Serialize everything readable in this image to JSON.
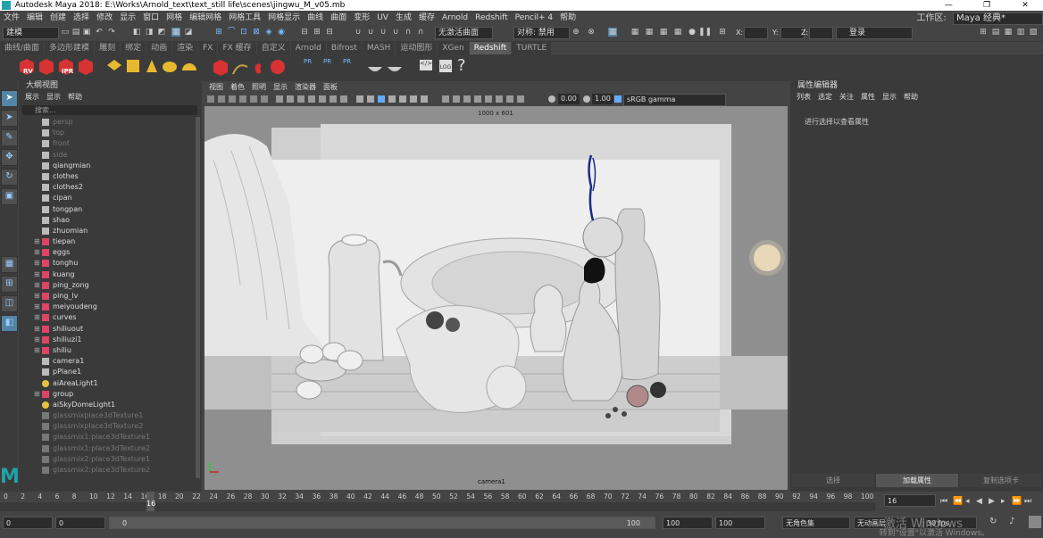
{
  "window": {
    "title": "Autodesk Maya 2018: E:\\Works\\Arnold_text\\text_still life\\scenes\\jingwu_M_v05.mb",
    "min": "—",
    "restore": "❐",
    "close": "✕"
  },
  "menubar": {
    "items": [
      "文件",
      "编辑",
      "创建",
      "选择",
      "修改",
      "显示",
      "窗口",
      "网格",
      "编辑网格",
      "网格工具",
      "网格显示",
      "曲线",
      "曲面",
      "变形",
      "UV",
      "生成",
      "缓存",
      "Arnold",
      "Redshift",
      "Pencil+ 4",
      "帮助"
    ],
    "workspace_label": "工作区:",
    "workspace_value": "Maya 经典*"
  },
  "statusline": {
    "mode": "建模",
    "live_surface": "无激活曲面",
    "symmetry": "对称: 禁用",
    "x": "X:",
    "y": "Y:",
    "z": "Z:",
    "login": "登录"
  },
  "shelf_tabs": [
    "曲线/曲面",
    "多边形建模",
    "雕刻",
    "绑定",
    "动画",
    "渲染",
    "FX",
    "FX 缓存",
    "自定义",
    "Arnold",
    "Bifrost",
    "MASH",
    "运动图形",
    "XGen",
    "Redshift",
    "TURTLE"
  ],
  "shelf_active": "Redshift",
  "shelf_labels": {
    "rv": "RV",
    "ipr": "IPR",
    "pr1": "PR",
    "pr2": "PR",
    "pr3": "PR",
    "log": "LOG",
    "help": "?"
  },
  "outliner": {
    "title": "大纲视图",
    "menus": [
      "展示",
      "显示",
      "帮助"
    ],
    "search_placeholder": "搜索...",
    "items": [
      {
        "name": "persp",
        "type": "camera",
        "dim": true,
        "expand": false
      },
      {
        "name": "top",
        "type": "camera",
        "dim": true,
        "expand": false
      },
      {
        "name": "front",
        "type": "camera",
        "dim": true,
        "expand": false
      },
      {
        "name": "side",
        "type": "camera",
        "dim": true,
        "expand": false
      },
      {
        "name": "qiangmian",
        "type": "mesh",
        "dim": false,
        "expand": false
      },
      {
        "name": "clothes",
        "type": "mesh",
        "dim": false,
        "expand": false
      },
      {
        "name": "clothes2",
        "type": "mesh",
        "dim": false,
        "expand": false
      },
      {
        "name": "cipan",
        "type": "mesh",
        "dim": false,
        "expand": false
      },
      {
        "name": "tongpan",
        "type": "mesh",
        "dim": false,
        "expand": false
      },
      {
        "name": "shao",
        "type": "mesh",
        "dim": false,
        "expand": false
      },
      {
        "name": "zhuomian",
        "type": "mesh",
        "dim": false,
        "expand": false
      },
      {
        "name": "tiepan",
        "type": "group",
        "dim": false,
        "expand": true
      },
      {
        "name": "eggs",
        "type": "group",
        "dim": false,
        "expand": true
      },
      {
        "name": "tonghu",
        "type": "group",
        "dim": false,
        "expand": true
      },
      {
        "name": "kuang",
        "type": "group",
        "dim": false,
        "expand": true
      },
      {
        "name": "ping_zong",
        "type": "group",
        "dim": false,
        "expand": true
      },
      {
        "name": "ping_lv",
        "type": "group",
        "dim": false,
        "expand": true
      },
      {
        "name": "meiyoudeng",
        "type": "group",
        "dim": false,
        "expand": true
      },
      {
        "name": "curves",
        "type": "group",
        "dim": false,
        "expand": true
      },
      {
        "name": "shiliuout",
        "type": "group",
        "dim": false,
        "expand": true
      },
      {
        "name": "shiliuzi1",
        "type": "group",
        "dim": false,
        "expand": true
      },
      {
        "name": "shiliu",
        "type": "group",
        "dim": false,
        "expand": true
      },
      {
        "name": "camera1",
        "type": "camera",
        "dim": false,
        "expand": false
      },
      {
        "name": "pPlane1",
        "type": "mesh",
        "dim": false,
        "expand": false
      },
      {
        "name": "aiAreaLight1",
        "type": "light",
        "dim": false,
        "expand": false
      },
      {
        "name": "group",
        "type": "group",
        "dim": false,
        "expand": true
      },
      {
        "name": "aiSkyDomeLight1",
        "type": "sky",
        "dim": false,
        "expand": false
      },
      {
        "name": "glassmixplace3dTexture1",
        "type": "texture",
        "dim": true,
        "expand": false
      },
      {
        "name": "glassmixplace3dTexture2",
        "type": "texture",
        "dim": true,
        "expand": false
      },
      {
        "name": "glassmix1:place3dTexture1",
        "type": "texture",
        "dim": true,
        "expand": false
      },
      {
        "name": "glassmix1:place3dTexture2",
        "type": "texture",
        "dim": true,
        "expand": false
      },
      {
        "name": "glassmix2:place3dTexture1",
        "type": "texture",
        "dim": true,
        "expand": false
      },
      {
        "name": "glassmix2:place3dTexture2",
        "type": "texture",
        "dim": true,
        "expand": false
      }
    ]
  },
  "viewport": {
    "menus": [
      "视图",
      "着色",
      "照明",
      "显示",
      "渲染器",
      "面板"
    ],
    "exposure": "0.00",
    "gamma": "1.00",
    "color_space": "sRGB gamma",
    "resolution": "1000 x 601",
    "camera": "camera1"
  },
  "attribute_editor": {
    "title": "属性编辑器",
    "menus": [
      "列表",
      "选定",
      "关注",
      "属性",
      "显示",
      "帮助"
    ],
    "hint": "进行选择以查看属性",
    "buttons": {
      "select": "选择",
      "load": "加载属性",
      "copy": "复制选项卡"
    }
  },
  "timeline": {
    "ticks": [
      "0",
      "2",
      "4",
      "6",
      "8",
      "10",
      "12",
      "14",
      "16",
      "18",
      "20",
      "22",
      "24",
      "26",
      "28",
      "30",
      "32",
      "34",
      "36",
      "38",
      "40",
      "42",
      "44",
      "46",
      "48",
      "50",
      "52",
      "54",
      "56",
      "58",
      "60",
      "62",
      "64",
      "66",
      "68",
      "70",
      "72",
      "74",
      "76",
      "78",
      "80",
      "82",
      "84",
      "86",
      "88",
      "90",
      "92",
      "94",
      "96",
      "98",
      "100"
    ],
    "current_frame": "16",
    "current_field": "16"
  },
  "range": {
    "start": "0",
    "anim_start": "0",
    "playback_start": "0",
    "playback_end": "100",
    "end": "100",
    "anim_end": "100",
    "char_set": "无角色集",
    "anim_layer": "无动画层",
    "fps": "30 fps"
  },
  "watermark": {
    "line1": "激活 Windows",
    "line2": "转到\"设置\"以激活 Windows。"
  },
  "colors": {
    "accent": "#1fa3a8",
    "panel": "#444444",
    "dark_field": "#2b2b2b",
    "rs_red": "#d93232"
  }
}
